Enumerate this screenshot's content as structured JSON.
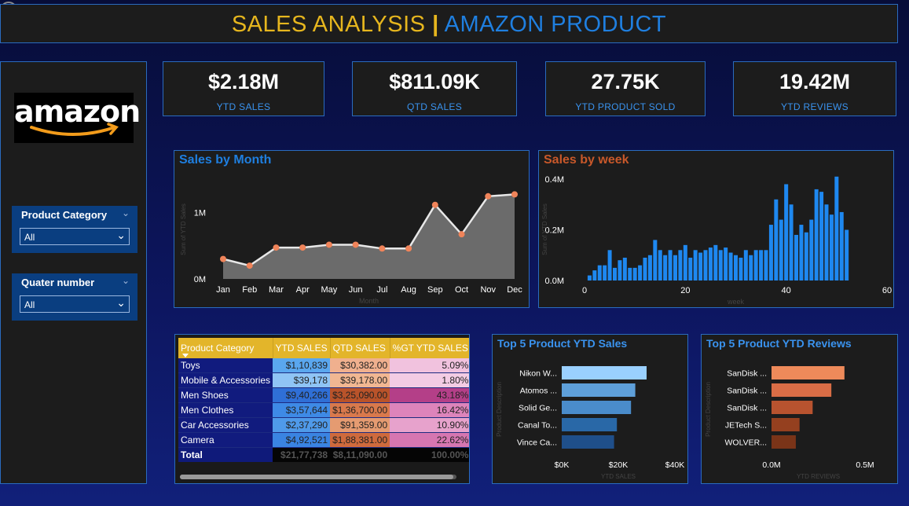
{
  "header": {
    "title_part1": "SALES ANALYSIS ",
    "separator": "|",
    "title_part2": " AMAZON PRODUCT"
  },
  "logo": {
    "text": "amazon"
  },
  "slicers": [
    {
      "title": "Product Category",
      "value": "All"
    },
    {
      "title": "Quater number",
      "value": "All"
    }
  ],
  "kpis": [
    {
      "value": "$2.18M",
      "label": "YTD SALES"
    },
    {
      "value": "$811.09K",
      "label": "QTD SALES"
    },
    {
      "value": "27.75K",
      "label": "YTD PRODUCT SOLD"
    },
    {
      "value": "19.42M",
      "label": "YTD REVIEWS"
    }
  ],
  "colors": {
    "accent_blue": "#1f7fe0",
    "gold": "#e6b61e",
    "orange_title": "#c8582a",
    "bar_blue": "#1e88f0",
    "point_orange": "#f0845a"
  },
  "chart_data": [
    {
      "type": "area",
      "title": "Sales by Month",
      "xlabel": "Month",
      "ylabel": "Sum of YTD Sales",
      "categories": [
        "Jan",
        "Feb",
        "Mar",
        "Apr",
        "May",
        "Jun",
        "Jul",
        "Aug",
        "Sep",
        "Oct",
        "Nov",
        "Dec"
      ],
      "values": [
        0.21,
        0.14,
        0.33,
        0.33,
        0.36,
        0.36,
        0.32,
        0.32,
        0.78,
        0.47,
        0.87,
        0.89
      ],
      "ylim": [
        0,
        1.1
      ],
      "yticks": [
        "0M",
        "1M"
      ],
      "ytick_values": [
        0,
        0.7
      ]
    },
    {
      "type": "bar",
      "title": "Sales by week",
      "xlabel": "week",
      "ylabel": "Sum of YTD Sales",
      "x": [
        1,
        2,
        3,
        4,
        5,
        6,
        7,
        8,
        9,
        10,
        11,
        12,
        13,
        14,
        15,
        16,
        17,
        18,
        19,
        20,
        21,
        22,
        23,
        24,
        25,
        26,
        27,
        28,
        29,
        30,
        31,
        32,
        33,
        34,
        35,
        36,
        37,
        38,
        39,
        40,
        41,
        42,
        43,
        44,
        45,
        46,
        47,
        48,
        49,
        50,
        51,
        52
      ],
      "values": [
        0.02,
        0.04,
        0.06,
        0.06,
        0.12,
        0.05,
        0.08,
        0.09,
        0.05,
        0.05,
        0.06,
        0.09,
        0.1,
        0.16,
        0.12,
        0.1,
        0.12,
        0.1,
        0.12,
        0.14,
        0.09,
        0.12,
        0.11,
        0.12,
        0.13,
        0.14,
        0.12,
        0.13,
        0.11,
        0.1,
        0.09,
        0.12,
        0.1,
        0.12,
        0.12,
        0.12,
        0.22,
        0.32,
        0.24,
        0.38,
        0.3,
        0.18,
        0.22,
        0.19,
        0.24,
        0.36,
        0.35,
        0.3,
        0.26,
        0.41,
        0.27,
        0.2
      ],
      "xticks": [
        0,
        20,
        40,
        60
      ],
      "xlim": [
        0,
        60
      ],
      "ylim": [
        0,
        0.4
      ],
      "yticks": [
        "0.0M",
        "0.2M",
        "0.4M"
      ]
    },
    {
      "type": "bar",
      "orientation": "horizontal",
      "title": "Top 5 Product YTD Sales",
      "xlabel": "YTD SALES",
      "ylabel": "Product Description",
      "categories": [
        "Nikon W...",
        "Atomos ...",
        "Solid Ge...",
        "Canal To...",
        "Vince Ca..."
      ],
      "values": [
        30000,
        26000,
        24500,
        19500,
        18500
      ],
      "xticks": [
        "$0K",
        "$20K",
        "$40K"
      ],
      "xlim": [
        0,
        40000
      ],
      "colors": [
        "#9ad0ff",
        "#5e9fd9",
        "#4a8ccb",
        "#2968a7",
        "#1f4f8a"
      ]
    },
    {
      "type": "bar",
      "orientation": "horizontal",
      "title": "Top 5 Product YTD Reviews",
      "xlabel": "YTD REVIEWS",
      "ylabel": "Product Description",
      "categories": [
        "SanDisk ...",
        "SanDisk ...",
        "SanDisk ...",
        "JETech S...",
        "WOLVER..."
      ],
      "values": [
        0.39,
        0.32,
        0.22,
        0.15,
        0.13
      ],
      "xticks": [
        "0.0M",
        "0.5M"
      ],
      "xlim": [
        0,
        0.5
      ],
      "colors": [
        "#ee8a5a",
        "#d96d46",
        "#b8532f",
        "#95401f",
        "#7a3418"
      ]
    },
    {
      "type": "table",
      "columns": [
        "Product Category",
        "YTD SALES",
        "QTD SALES",
        "%GT YTD SALES"
      ],
      "rows": [
        [
          "Toys",
          "$1,10,839",
          "$30,382.00",
          "5.09%"
        ],
        [
          "Mobile & Accessories",
          "$39,178",
          "$39,178.00",
          "1.80%"
        ],
        [
          "Men Shoes",
          "$9,40,266",
          "$3,25,090.00",
          "43.18%"
        ],
        [
          "Men Clothes",
          "$3,57,644",
          "$1,36,700.00",
          "16.42%"
        ],
        [
          "Car Accessories",
          "$2,37,290",
          "$91,359.00",
          "10.90%"
        ],
        [
          "Camera",
          "$4,92,521",
          "$1,88,381.00",
          "22.62%"
        ]
      ],
      "total": [
        "Total",
        "$21,77,738",
        "$8,11,090.00",
        "100.00%"
      ]
    }
  ]
}
